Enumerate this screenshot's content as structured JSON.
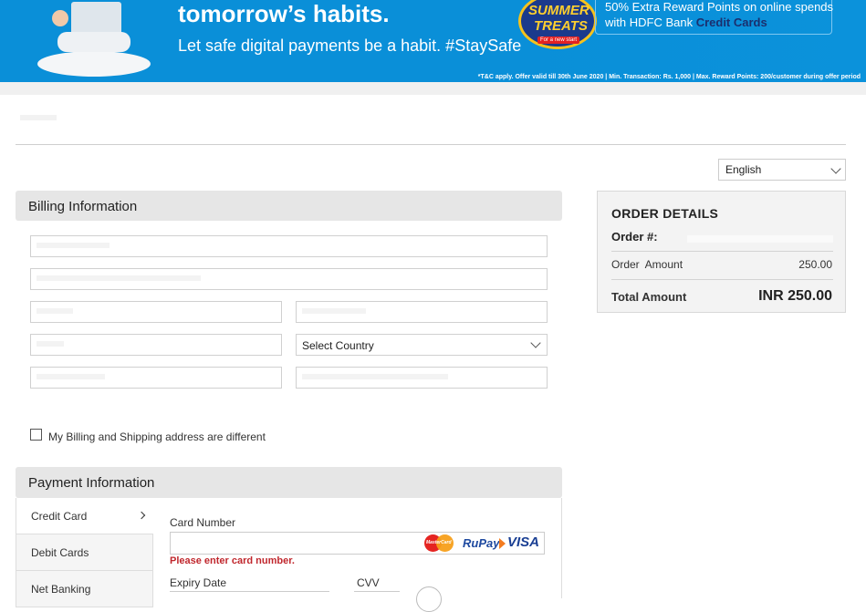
{
  "banner": {
    "headline": "tomorrow’s habits.",
    "subline": "Let safe digital payments be a habit. #StaySafe",
    "badge_line1": "SUMMER",
    "badge_line2": "TREATS",
    "badge_line3": "For a new start",
    "offer_line1": "50% Extra Reward Points on online spends",
    "offer_line2_prefix": "with HDFC Bank ",
    "offer_line2_highlight": "Credit Cards",
    "terms": "*T&C apply. Offer valid till 30th June 2020 | Min. Transaction: Rs. 1,000 | Max. Reward Points: 200/customer during offer period"
  },
  "language": {
    "selected": "English"
  },
  "billing": {
    "title": "Billing Information",
    "country_select": "Select Country",
    "different_address_label": "My Billing and Shipping address are different",
    "different_address_checked": false
  },
  "order": {
    "title": "ORDER DETAILS",
    "order_no_label": "Order #:",
    "amount_label": "Order  Amount",
    "amount_value": "250.00",
    "total_label": "Total Amount",
    "total_value": "INR 250.00"
  },
  "payment": {
    "title": "Payment Information",
    "tabs": [
      {
        "label": "Credit Card",
        "active": true
      },
      {
        "label": "Debit Cards",
        "active": false
      },
      {
        "label": "Net Banking",
        "active": false
      }
    ],
    "card_number_label": "Card Number",
    "card_number_error": "Please enter card number.",
    "expiry_label": "Expiry Date",
    "cvv_label": "CVV",
    "brands": {
      "mastercard": "MasterCard",
      "rupay": "RuPay",
      "visa": "VISA"
    }
  }
}
